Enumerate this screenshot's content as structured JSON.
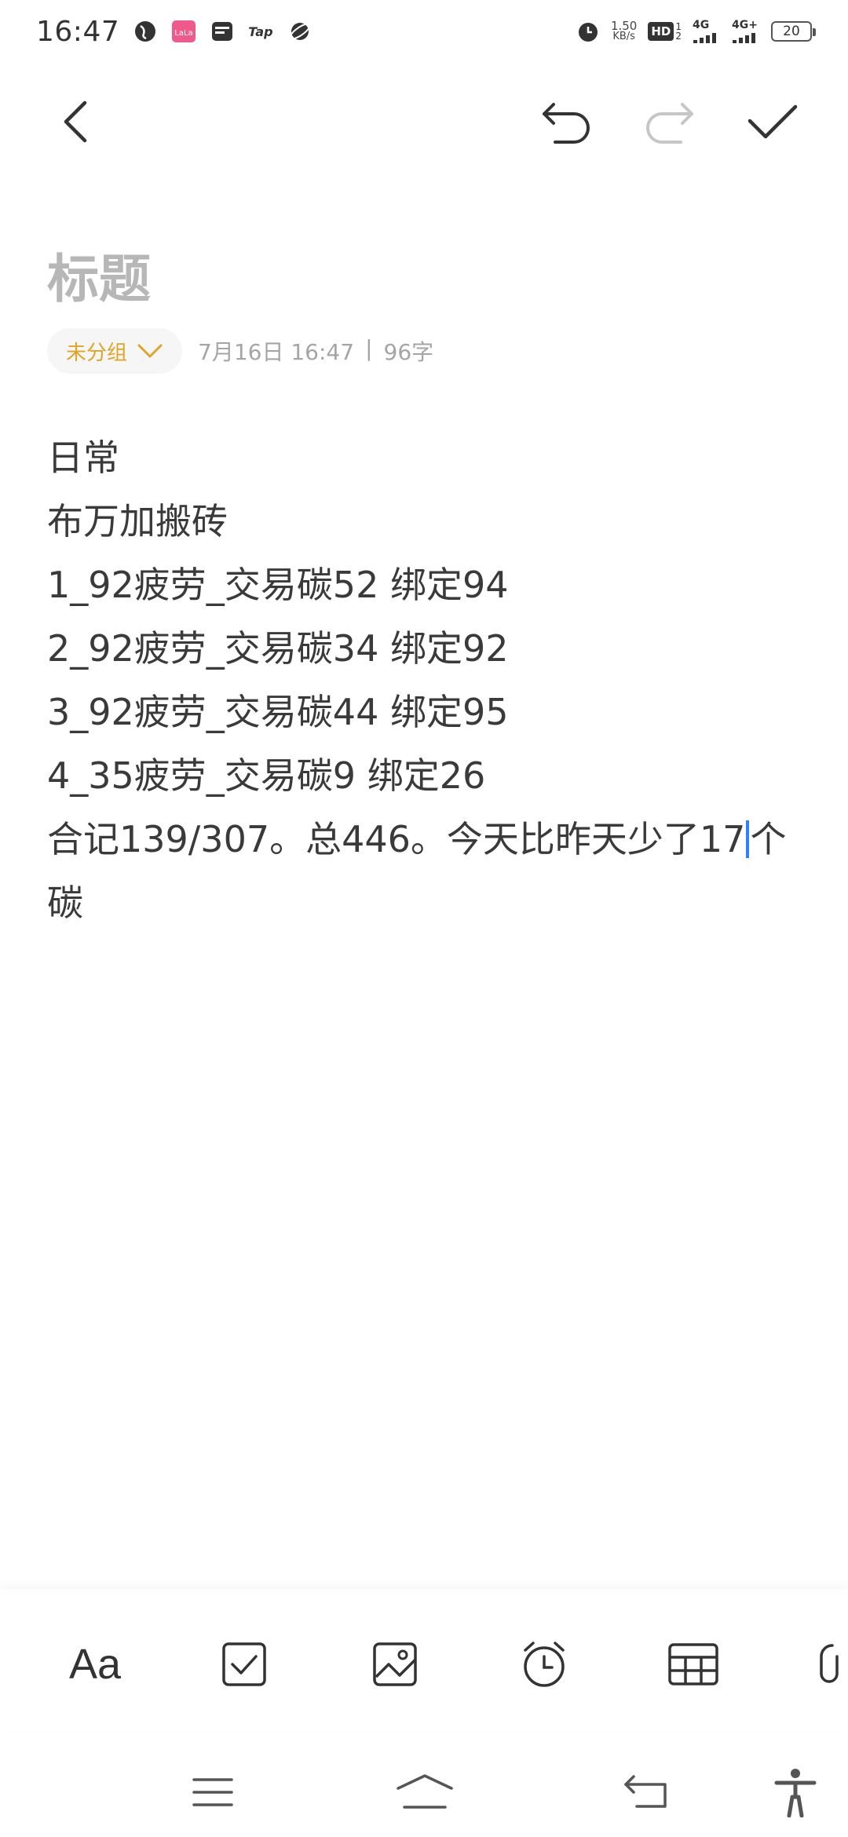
{
  "status": {
    "time": "16:47",
    "app_icons": [
      "globe-icon",
      "lala-app-icon",
      "wallet-icon",
      "tap-app-icon",
      "planet-icon"
    ],
    "tap_label": "Tap",
    "lala_label": "LaLa",
    "net_speed_value": "1.50",
    "net_speed_unit": "KB/s",
    "hd_label": "HD",
    "sim_label_1": "4G",
    "sim_label_2": "4G+",
    "battery": "20"
  },
  "toolbar": {
    "back_icon": "chevron-left-icon",
    "undo_icon": "undo-icon",
    "redo_icon": "redo-icon",
    "confirm_icon": "check-icon"
  },
  "note": {
    "title_placeholder": "标题",
    "group_label": "未分组",
    "date": "7月16日 16:47",
    "separator": "|",
    "word_count": "96字",
    "lines": [
      "日常",
      "布万加搬砖",
      "1_92疲劳_交易碳52 绑定94",
      "2_92疲劳_交易碳34 绑定92",
      "3_92疲劳_交易碳44 绑定95",
      "4_35疲劳_交易碳9 绑定26"
    ],
    "line7_before_cursor": "合记139/307。总446。今天比昨天少了17",
    "line7_after_cursor": "个",
    "line8": "碳"
  },
  "format_bar": {
    "text_style_label": "Aa",
    "icons": [
      "checkbox-icon",
      "image-icon",
      "alarm-icon",
      "table-icon",
      "attachment-icon"
    ]
  },
  "nav_bar": {
    "icons": [
      "menu-icon",
      "home-icon",
      "back-icon",
      "accessibility-icon"
    ]
  },
  "colors": {
    "accent": "#e0a526",
    "cursor": "#2f7fff",
    "title_placeholder": "#b7b7b7",
    "meta": "#a5a5a5"
  }
}
